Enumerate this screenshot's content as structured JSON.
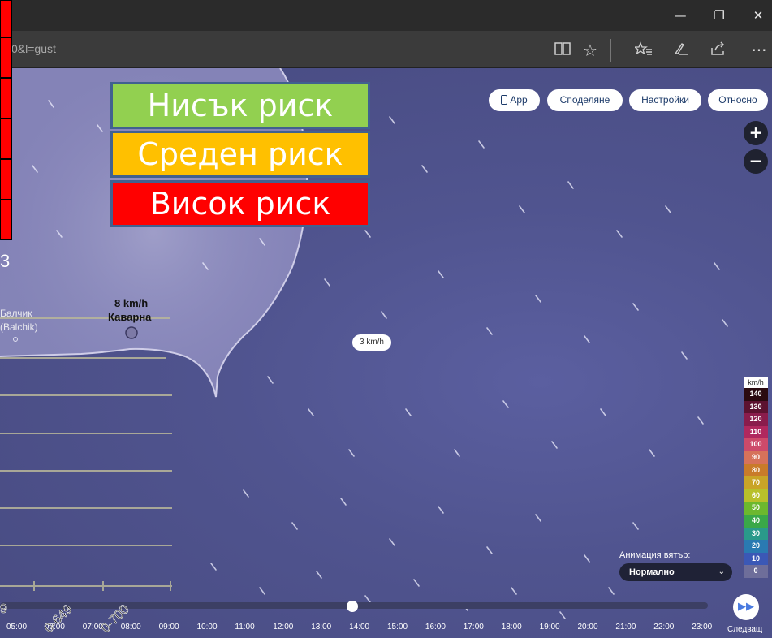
{
  "browser": {
    "url": "0&l=gust",
    "window_controls": {
      "minimize": "—",
      "restore": "❐",
      "close": "✕"
    },
    "toolbar_icons": [
      "reading-view-icon",
      "favorite-star-icon",
      "favorites-hub-icon",
      "pen-icon",
      "share-icon",
      "more-icon"
    ],
    "more_label": "···"
  },
  "risk_legend": {
    "low": "Нисък риск",
    "medium": "Среден риск",
    "high": "Висок риск",
    "colors": {
      "low": "#92d050",
      "medium": "#ffc000",
      "high": "#ff0000"
    }
  },
  "top_buttons": {
    "app": "App",
    "share": "Споделяне",
    "settings": "Настройки",
    "about": "Относно"
  },
  "zoom": {
    "in": "+",
    "out": "−"
  },
  "map_labels": {
    "balchik_bg": "Балчик",
    "balchik_en": "(Balchik)",
    "kavarna_speed": "8 km/h",
    "kavarna": "Каварна",
    "sea_speed": "3 km/h",
    "left_edge_glyph": "3"
  },
  "wind_scale": {
    "unit": "km/h",
    "steps": [
      {
        "value": "140",
        "color": "#2a0a10"
      },
      {
        "value": "130",
        "color": "#5c1230"
      },
      {
        "value": "120",
        "color": "#8a1c4c"
      },
      {
        "value": "110",
        "color": "#b0285e"
      },
      {
        "value": "100",
        "color": "#cd4a6a"
      },
      {
        "value": "90",
        "color": "#d6725a"
      },
      {
        "value": "80",
        "color": "#c97b2a"
      },
      {
        "value": "70",
        "color": "#c9a428"
      },
      {
        "value": "60",
        "color": "#b8c02a"
      },
      {
        "value": "50",
        "color": "#6cb82e"
      },
      {
        "value": "40",
        "color": "#3aa848"
      },
      {
        "value": "30",
        "color": "#2a9a8a"
      },
      {
        "value": "20",
        "color": "#2a7ab2"
      },
      {
        "value": "10",
        "color": "#3b58b6"
      },
      {
        "value": "0",
        "color": "#6e6e9a"
      }
    ]
  },
  "animation": {
    "label": "Анимация вятър:",
    "selected": "Нормално"
  },
  "timeline": {
    "hours": [
      "05:00",
      "06:00",
      "07:00",
      "08:00",
      "09:00",
      "10:00",
      "11:00",
      "12:00",
      "13:00",
      "14:00",
      "15:00",
      "16:00",
      "17:00",
      "18:00",
      "19:00",
      "20:00",
      "21:00",
      "22:00",
      "23:00"
    ],
    "current_hour": "14:00",
    "next_label": "Следващ"
  },
  "overlays": {
    "diag_1": "0-649",
    "diag_2": "0-700",
    "diag_edge": "9"
  }
}
